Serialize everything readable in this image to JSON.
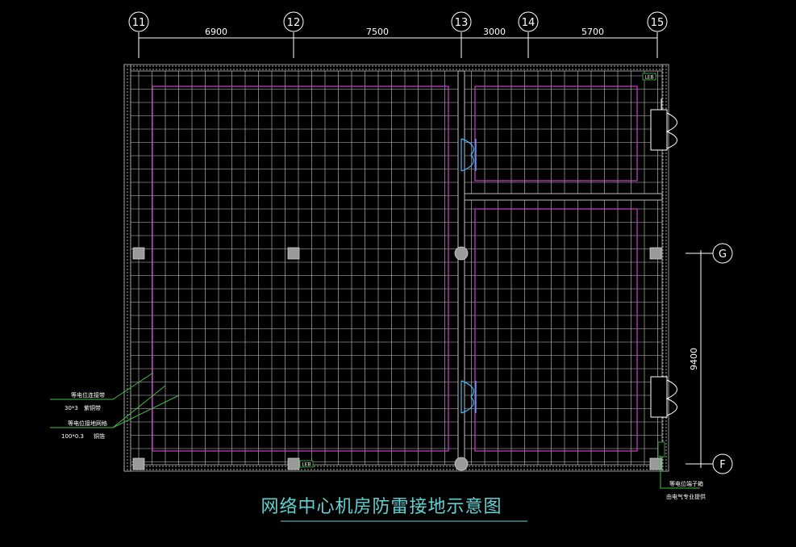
{
  "title": "网络中心机房防雷接地示意图",
  "colors": {
    "background": "#000000",
    "wall": "#b8b8b8",
    "grid": "#c8c8c8",
    "ring": "#d040d0",
    "title": "#5fd3d3",
    "annotation_line": "#40c040",
    "door": "#40c0ff"
  },
  "axes_top": [
    {
      "label": "11"
    },
    {
      "label": "12"
    },
    {
      "label": "13"
    },
    {
      "label": "14"
    },
    {
      "label": "15"
    }
  ],
  "dims_top": [
    "6900",
    "7500",
    "3000",
    "5700"
  ],
  "axes_right": [
    {
      "label": "G"
    },
    {
      "label": "F"
    }
  ],
  "dim_right": "9400",
  "tags": [
    "LEB",
    "LEB",
    "LEB"
  ],
  "notes_left": {
    "line1_label": "等电位连接带",
    "line1_spec": "30*3",
    "line1_material": "紫铜带",
    "line2_label": "等电位接地网格",
    "line2_spec": "100*0.3",
    "line2_material": "铜箔"
  },
  "notes_right": {
    "line1": "等电位端子箱",
    "line2": "由电气专业提供"
  }
}
